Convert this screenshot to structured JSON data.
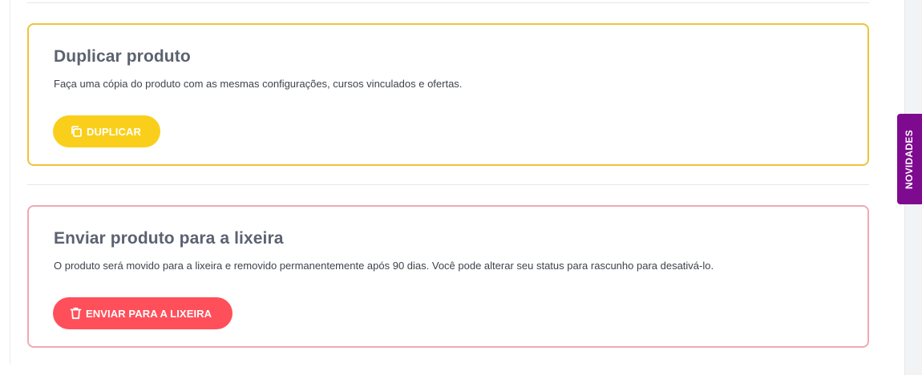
{
  "duplicate_section": {
    "title": "Duplicar produto",
    "description": "Faça uma cópia do produto com as mesmas configurações, cursos vinculados e ofertas.",
    "button_label": "DUPLICAR",
    "button_icon": "copy-icon",
    "accent_color": "#f9cf1b"
  },
  "trash_section": {
    "title": "Enviar produto para a lixeira",
    "description": "O produto será movido para a lixeira e removido permanentemente após 90 dias. Você pode alterar seu status para rascunho para desativá-lo.",
    "button_label": "ENVIAR PARA A LIXEIRA",
    "button_icon": "trash-icon",
    "accent_color": "#ff4f5a"
  },
  "side_tab": {
    "label": "NOVIDADES",
    "color": "#7e0b8f"
  }
}
